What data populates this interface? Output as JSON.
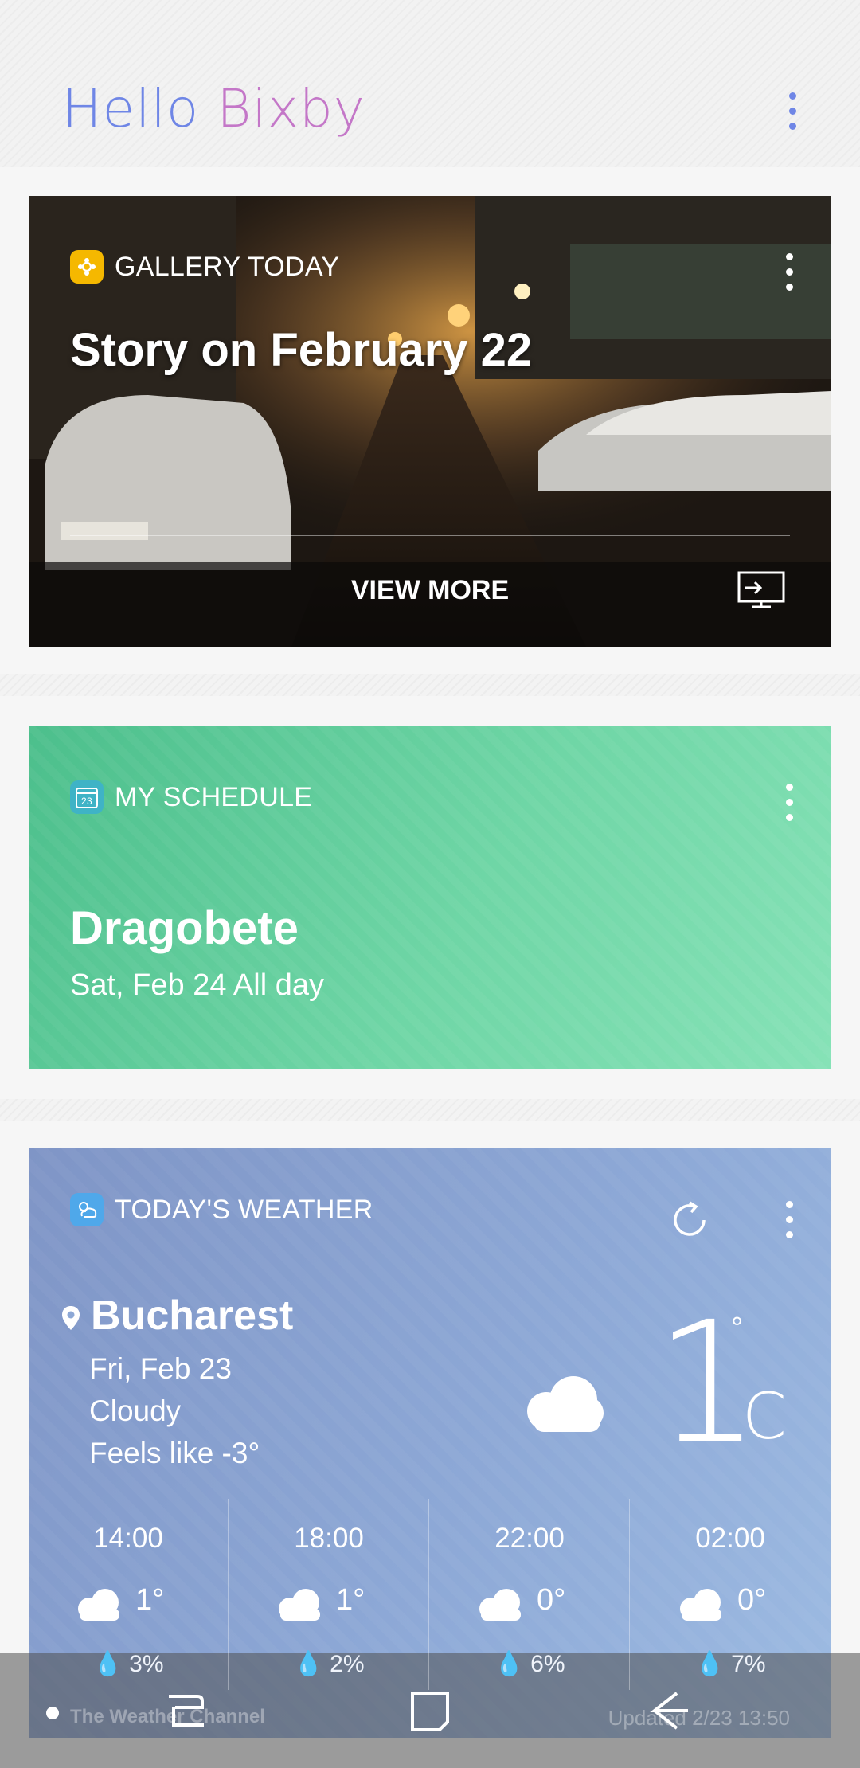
{
  "header": {
    "logo_hello": "Hello",
    "logo_bixby": "Bixby",
    "menu_icon": "more-vertical-icon"
  },
  "gallery": {
    "label": "GALLERY TODAY",
    "title": "Story on February 22",
    "view_more": "VIEW MORE",
    "badge_color": "#f5b800",
    "cast_icon": "screen-cast-icon"
  },
  "schedule": {
    "label": "MY SCHEDULE",
    "calendar_day": "23",
    "event_title": "Dragobete",
    "event_time": "Sat, Feb 24 All day",
    "accent": "#4cbf8c"
  },
  "weather": {
    "label": "TODAY'S WEATHER",
    "city": "Bucharest",
    "date": "Fri, Feb 23",
    "condition": "Cloudy",
    "feels_like": "Feels like -3°",
    "temperature": "1",
    "degree": "°",
    "unit": "C",
    "hourly": [
      {
        "time": "14:00",
        "temp": "1°",
        "precip": "3%"
      },
      {
        "time": "18:00",
        "temp": "1°",
        "precip": "2%"
      },
      {
        "time": "22:00",
        "temp": "0°",
        "precip": "6%"
      },
      {
        "time": "02:00",
        "temp": "0°",
        "precip": "7%"
      }
    ],
    "source": "The Weather Channel",
    "updated": "Updated 2/23 13:50",
    "accent": "#8da8d6"
  },
  "navigation": {
    "recents_icon": "recent-apps-icon",
    "home_icon": "home-icon",
    "back_icon": "back-icon"
  }
}
